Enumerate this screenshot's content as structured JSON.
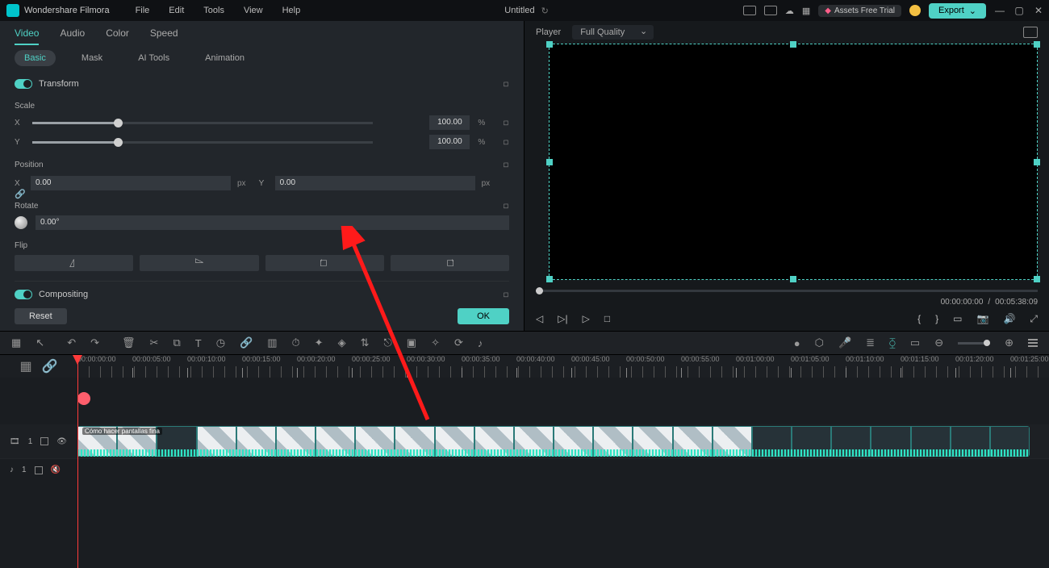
{
  "titlebar": {
    "app_name": "Wondershare Filmora",
    "menus": {
      "file": "File",
      "edit": "Edit",
      "tools": "Tools",
      "view": "View",
      "help": "Help"
    },
    "project_title": "Untitled",
    "assets_label": "Assets Free Trial",
    "export_label": "Export"
  },
  "panel": {
    "tabs1": {
      "video": "Video",
      "audio": "Audio",
      "color": "Color",
      "speed": "Speed"
    },
    "tabs2": {
      "basic": "Basic",
      "mask": "Mask",
      "ai": "AI Tools",
      "anim": "Animation"
    },
    "sections": {
      "transform": "Transform",
      "compositing": "Compositing"
    },
    "scale_label": "Scale",
    "scale_x": {
      "axis": "X",
      "value": "100.00",
      "unit": "%"
    },
    "scale_y": {
      "axis": "Y",
      "value": "100.00",
      "unit": "%"
    },
    "position_label": "Position",
    "position_x": {
      "axis": "X",
      "value": "0.00",
      "unit": "px"
    },
    "position_y": {
      "axis": "Y",
      "value": "0.00",
      "unit": "px"
    },
    "rotate_label": "Rotate",
    "rotate_value": "0.00°",
    "flip_label": "Flip",
    "reset_label": "Reset",
    "ok_label": "OK"
  },
  "player": {
    "label": "Player",
    "quality": "Full Quality",
    "time_current": "00:00:00:00",
    "time_sep": "/",
    "time_total": "00:05:38:09"
  },
  "timeline": {
    "ticks": [
      "00:00:00:00",
      "00:00:05:00",
      "00:00:10:00",
      "00:00:15:00",
      "00:00:20:00",
      "00:00:25:00",
      "00:00:30:00",
      "00:00:35:00",
      "00:00:40:00",
      "00:00:45:00",
      "00:00:50:00",
      "00:00:55:00",
      "00:01:00:00",
      "00:01:05:00",
      "00:01:10:00",
      "00:01:15:00",
      "00:01:20:00",
      "00:01:25:00"
    ],
    "clip_title": "Cómo hacer pantallas fina",
    "video_track_label": "1",
    "audio_track_label": "1"
  }
}
